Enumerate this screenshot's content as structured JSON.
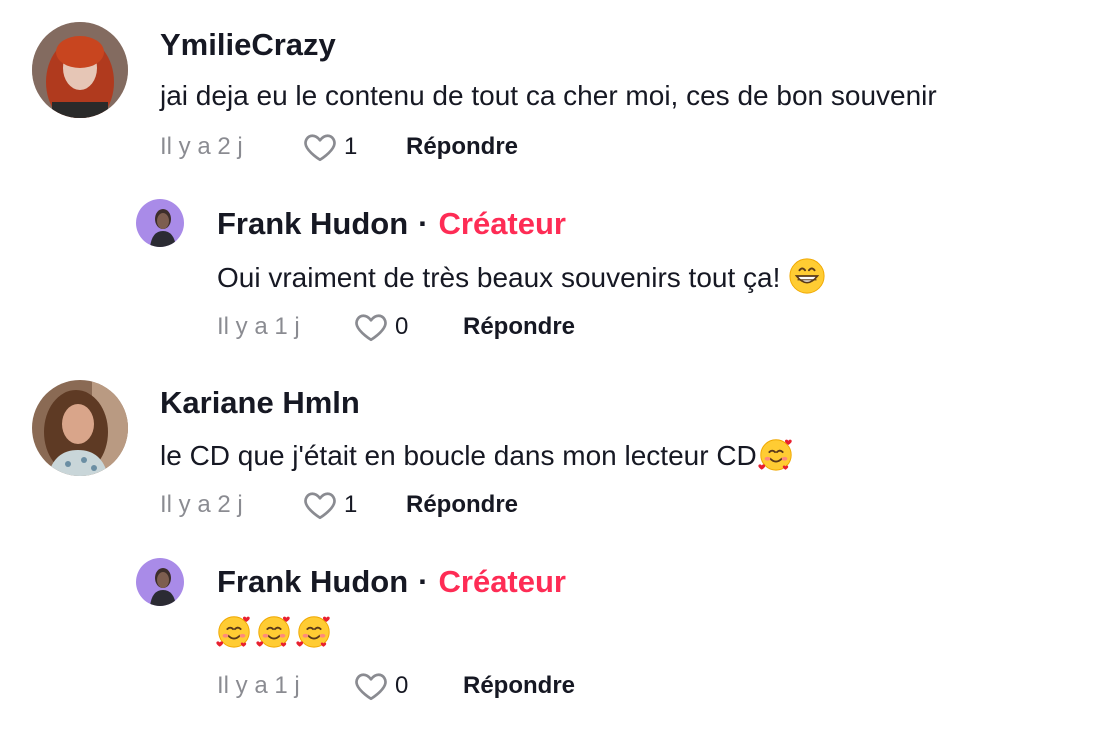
{
  "comments": [
    {
      "username": "YmilieCrazy",
      "text": "jai deja eu le contenu de tout ca cher moi, ces de bon souvenir",
      "time": "Il y a 2 j",
      "likes": "1",
      "reply_label": "Répondre"
    },
    {
      "username": "Frank Hudon",
      "dot": "·",
      "badge": "Créateur",
      "text": "Oui vraiment de très beaux souvenirs tout ça!",
      "emoji": "grinning-face-emoji",
      "time": "Il y a 1 j",
      "likes": "0",
      "reply_label": "Répondre"
    },
    {
      "username": "Kariane Hmln",
      "text": "le CD que j'était en boucle dans mon lecteur CD",
      "emoji": "smiling-face-with-hearts-emoji",
      "time": "Il y a 2 j",
      "likes": "1",
      "reply_label": "Répondre"
    },
    {
      "username": "Frank Hudon",
      "dot": "·",
      "badge": "Créateur",
      "text": "",
      "emoji": "smiling-face-with-hearts-emoji x3",
      "time": "Il y a 1 j",
      "likes": "0",
      "reply_label": "Répondre"
    }
  ],
  "colors": {
    "creator_badge": "#fe2c55",
    "meta_text": "#8a8b91",
    "primary_text": "#161823",
    "creator_avatar_bg": "#a98be8"
  }
}
